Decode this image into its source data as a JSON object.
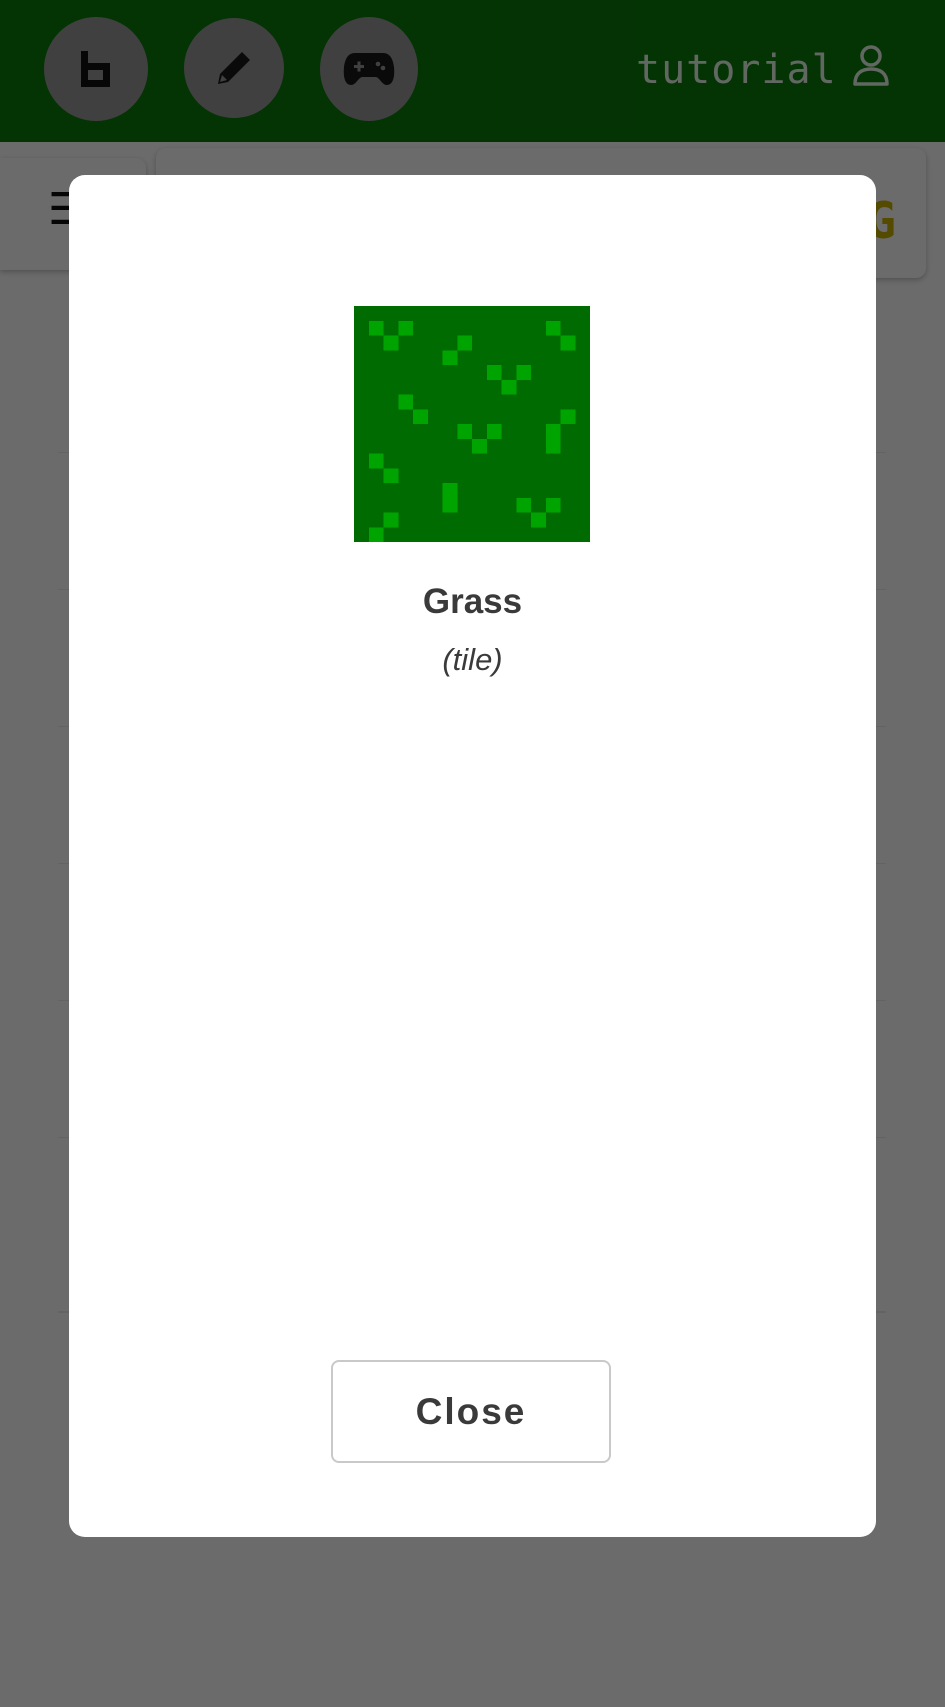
{
  "header": {
    "username": "tutorial",
    "buttons": [
      {
        "icon": "b-logo-icon"
      },
      {
        "icon": "pencil-icon"
      },
      {
        "icon": "gamepad-icon"
      }
    ],
    "user_icon": "person-icon"
  },
  "background": {
    "menu_icon": "☰",
    "logo_glyph": "G"
  },
  "modal": {
    "title": "Grass",
    "subtitle": "(tile)",
    "close_label": "Close",
    "tile_image": "grass-tile-icon"
  },
  "colors": {
    "header_bg": "#0b7a0b",
    "grass_dark": "#006b00",
    "grass_light": "#00a400",
    "accent_yellow": "#c9b200"
  }
}
